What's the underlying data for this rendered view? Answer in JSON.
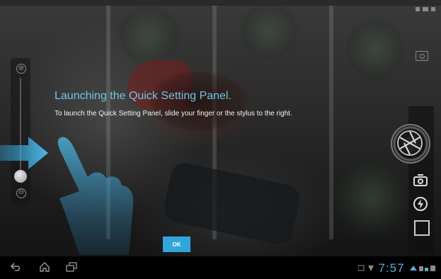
{
  "tutorial": {
    "title": "Launching the Quick Setting Panel.",
    "body": "To launch the Quick Setting Panel, slide your finger or the stylus to the right.",
    "ok_label": "OK"
  },
  "zoom": {
    "plus_symbol": "⊕",
    "minus_symbol": "⊖"
  },
  "navbar": {
    "back_icon": "back-icon",
    "home_icon": "home-icon",
    "recent_icon": "recent-apps-icon",
    "clock": "7:57"
  },
  "colors": {
    "accent_blue": "#2fa6dc",
    "title_blue": "#6fc5e8",
    "clock_blue": "#5aaed0"
  }
}
